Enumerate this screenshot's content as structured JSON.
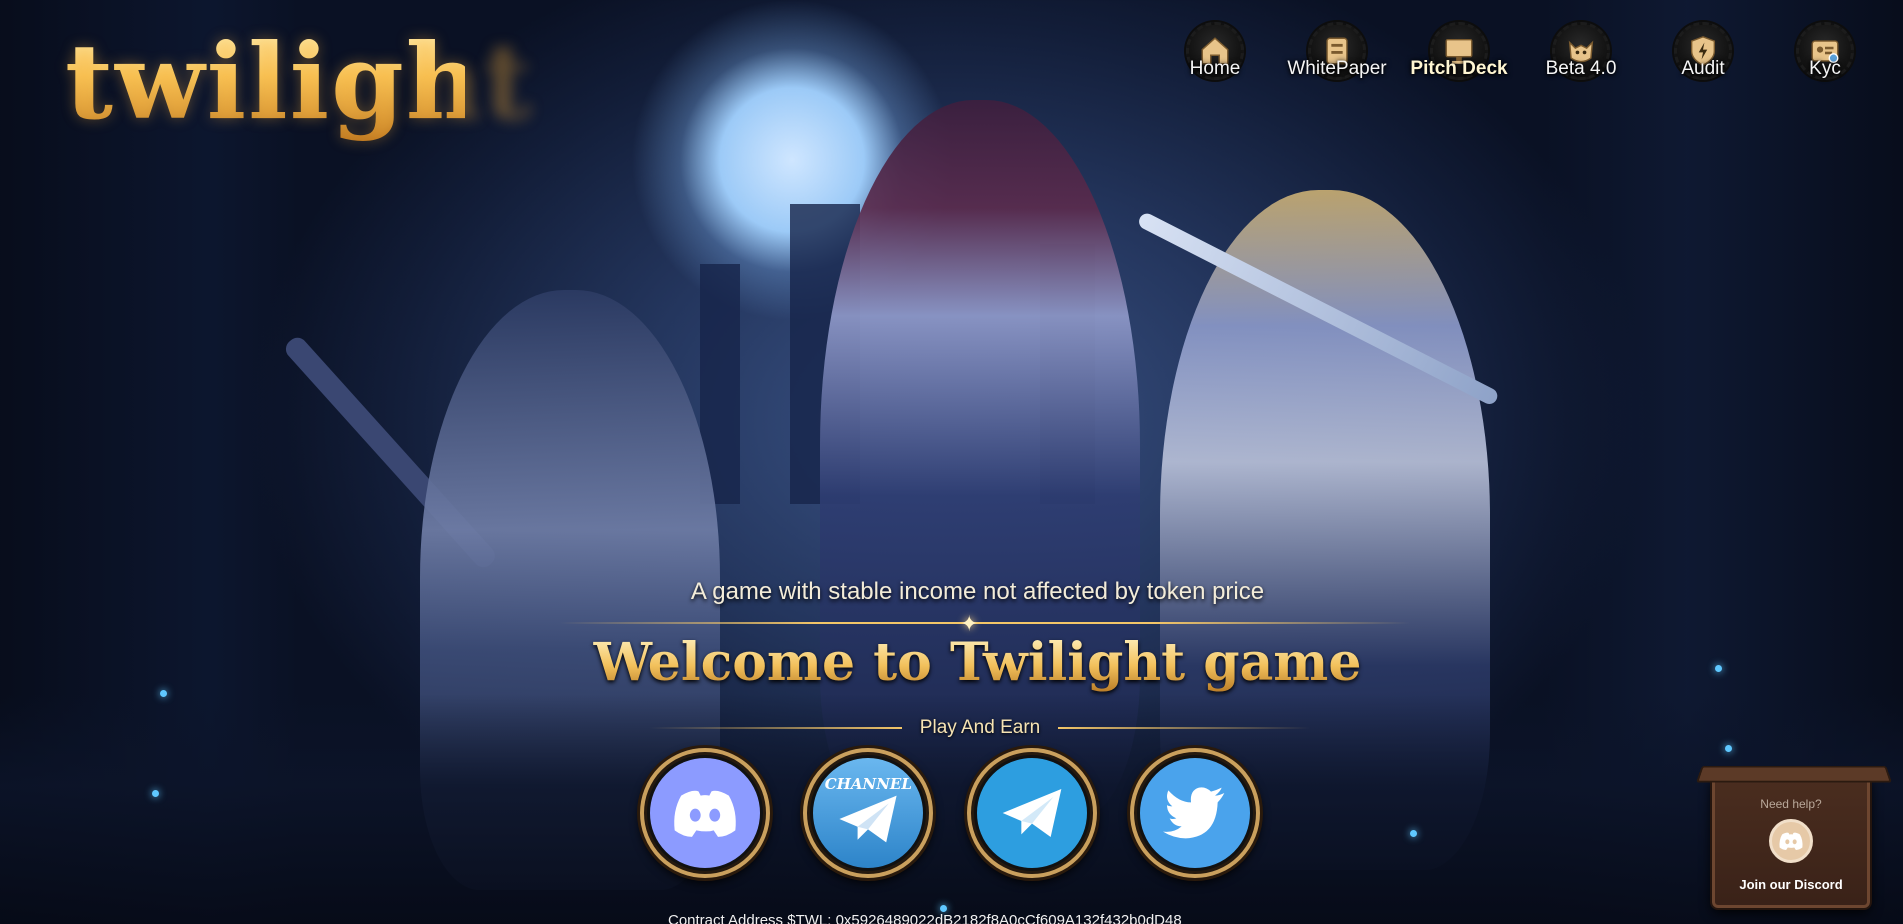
{
  "brand": {
    "logo_text": "twilight"
  },
  "nav": {
    "items": [
      {
        "label": "Home",
        "icon": "home-icon",
        "active": false
      },
      {
        "label": "WhitePaper",
        "icon": "book-icon",
        "active": false
      },
      {
        "label": "Pitch Deck",
        "icon": "monitor-icon",
        "active": true
      },
      {
        "label": "Beta 4.0",
        "icon": "mascot-icon",
        "active": false
      },
      {
        "label": "Audit",
        "icon": "shield-bolt-icon",
        "active": false
      },
      {
        "label": "Kyc",
        "icon": "id-card-icon",
        "active": false
      }
    ]
  },
  "hero": {
    "tagline": "A game with stable income not affected by token price",
    "headline": "Welcome to Twilight game",
    "subheadline": "Play And Earn"
  },
  "socials": [
    {
      "name": "Discord",
      "icon": "discord-icon"
    },
    {
      "name": "Telegram Channel",
      "icon": "telegram-channel-icon",
      "label": "CHANNEL"
    },
    {
      "name": "Telegram",
      "icon": "telegram-icon"
    },
    {
      "name": "Twitter",
      "icon": "twitter-icon"
    }
  ],
  "footer": {
    "contract": "Contract Address $TWL: 0x5926489022dB2182f8A0cCf609A132f432b0dD48"
  },
  "help_widget": {
    "title": "Need help?",
    "link": "Join our Discord",
    "icon": "discord-icon"
  },
  "colors": {
    "accent_gold": "#f3c668",
    "discord": "#8c9bff",
    "telegram": "#2d9ee0",
    "twitter": "#4aa3ec"
  }
}
